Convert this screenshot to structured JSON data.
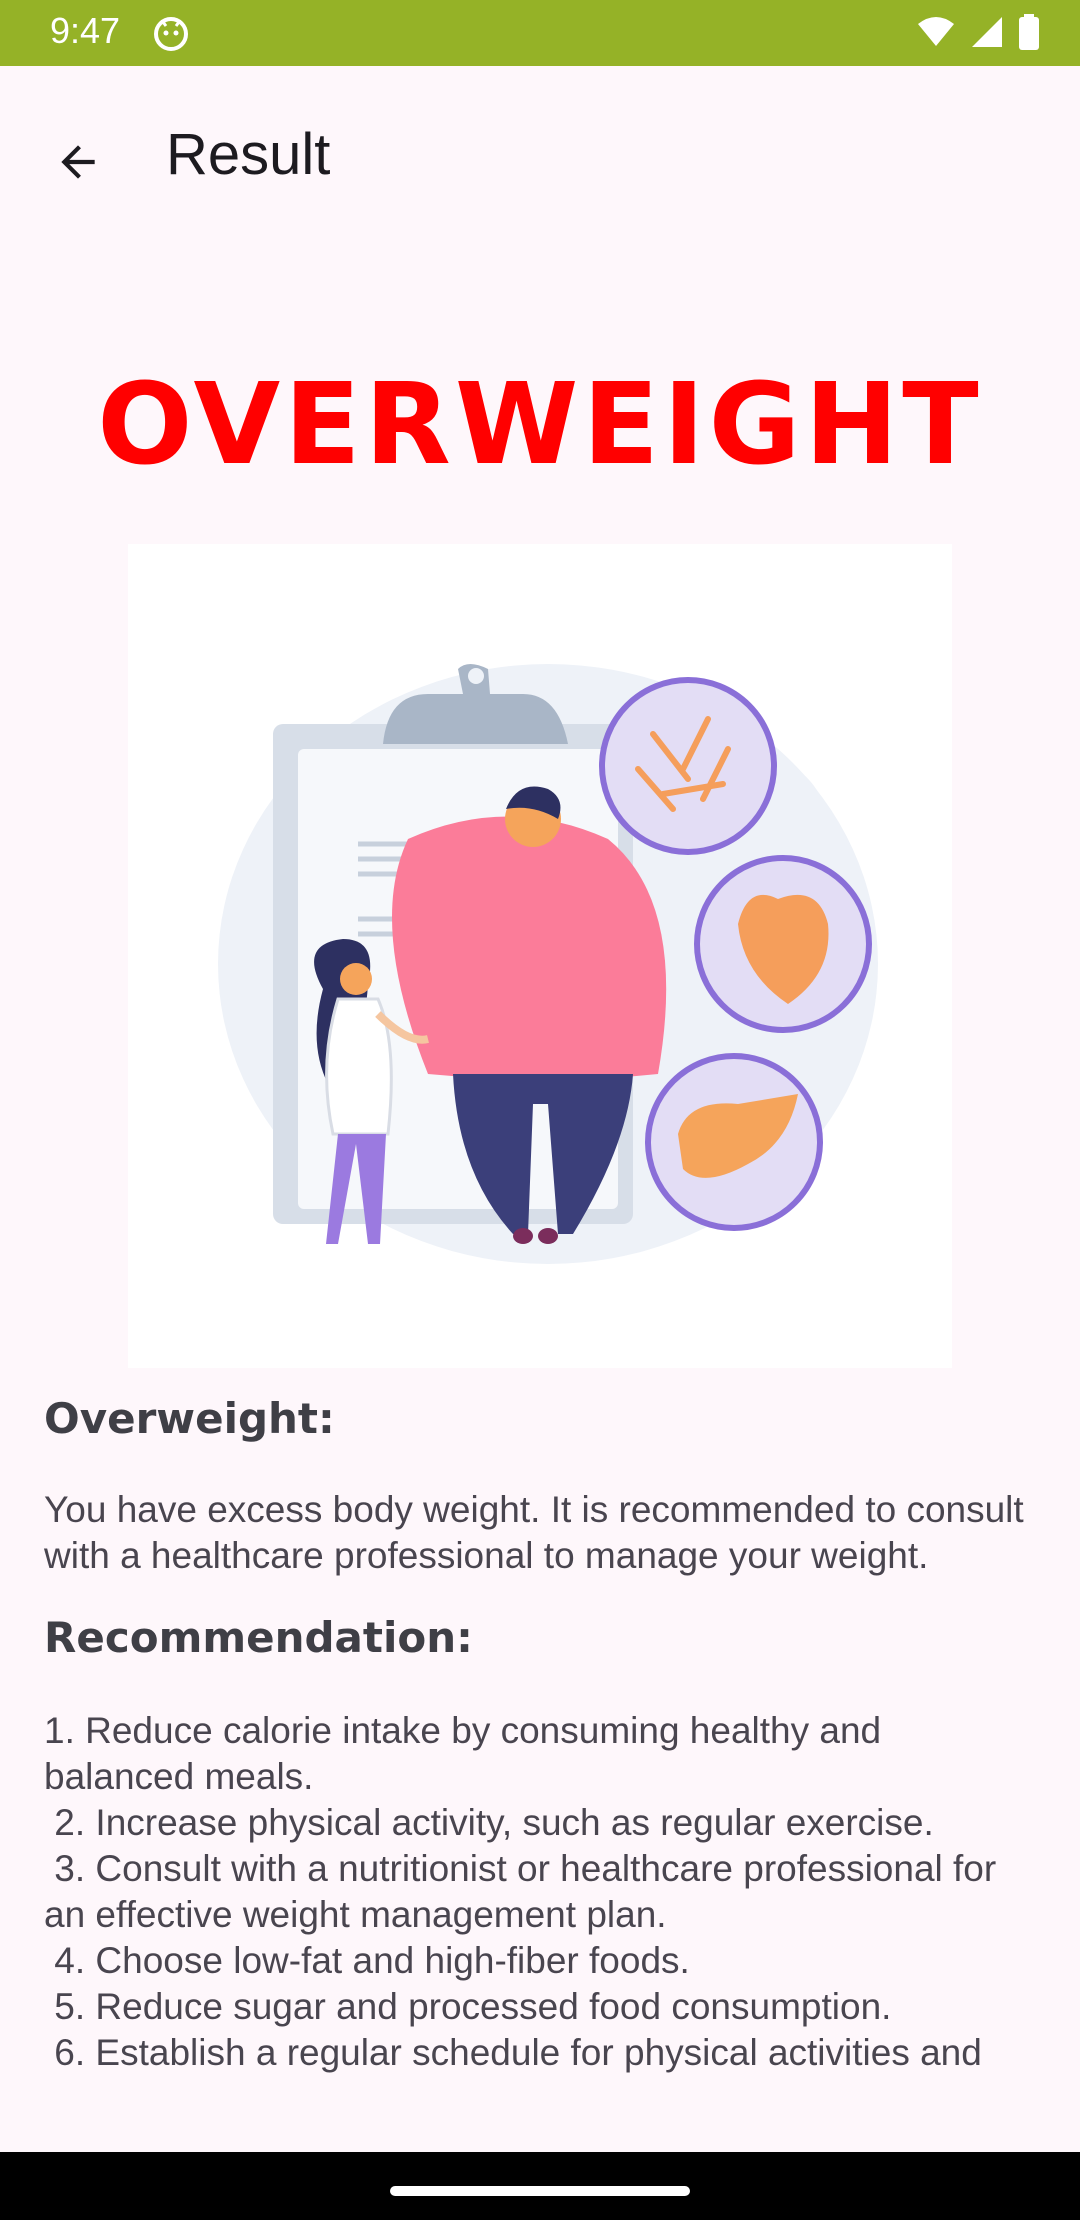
{
  "status_bar": {
    "time": "9:47",
    "icons": [
      "android-debug-icon",
      "wifi-icon",
      "signal-icon",
      "battery-icon"
    ]
  },
  "app_bar": {
    "title": "Result",
    "back_icon": "arrow-back-icon"
  },
  "result": {
    "category": "OVERWEIGHT",
    "category_color": "#ff0000"
  },
  "illustration": {
    "icon": "overweight-illustration"
  },
  "sections": {
    "overweight_heading": "Overweight:",
    "overweight_text": "You have excess body weight. It is recommended to consult with a healthcare professional to manage your weight.",
    "recommendation_heading": "Recommendation:",
    "recommendation_text": "1. Reduce calorie intake by consuming healthy and balanced meals.\n 2. Increase physical activity, such as regular exercise.\n 3. Consult with a nutritionist or healthcare professional for an effective weight management plan.\n 4. Choose low-fat and high-fiber foods.\n 5. Reduce sugar and processed food consumption.\n 6. Establish a regular schedule for physical activities and"
  },
  "colors": {
    "status_bar": "#95b227",
    "background": "#fef7fb",
    "heading_text": "#3f3f46"
  }
}
